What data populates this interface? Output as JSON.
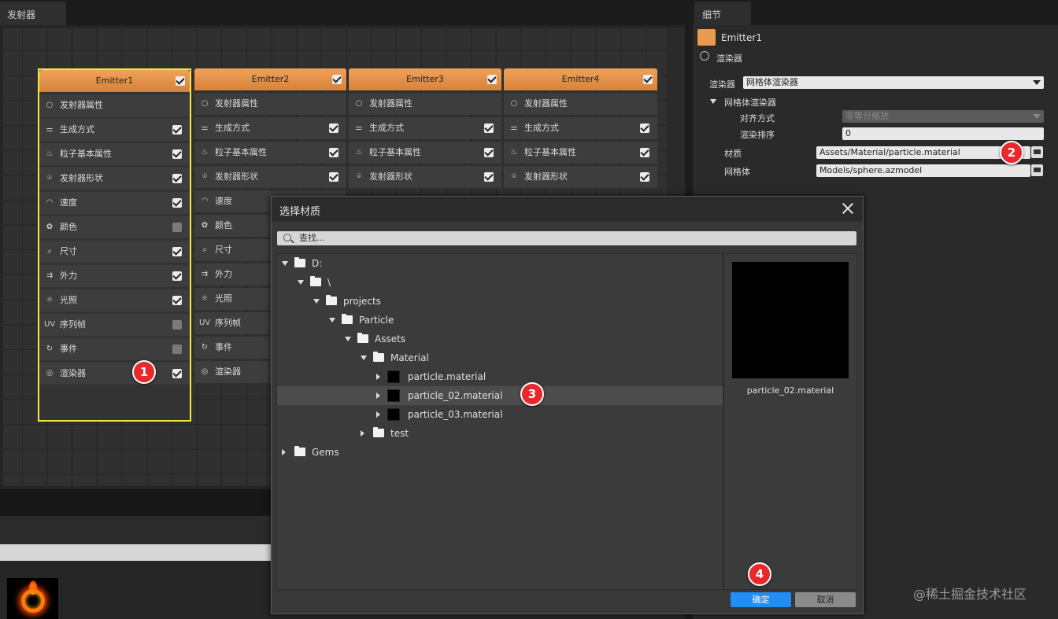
{
  "emitter_panel": {
    "tab_title": "发射器",
    "emitters": [
      {
        "name": "Emitter1",
        "enabled": true,
        "selected": true,
        "rows": [
          {
            "icon": "circle-icon",
            "label": "发射器属性",
            "checkbox": null
          },
          {
            "icon": "sliders-icon",
            "label": "生成方式",
            "checkbox": true
          },
          {
            "icon": "flame-icon",
            "label": "粒子基本属性",
            "checkbox": true
          },
          {
            "icon": "location-icon",
            "label": "发射器形状",
            "checkbox": true
          },
          {
            "icon": "gauge-icon",
            "label": "速度",
            "checkbox": true
          },
          {
            "icon": "palette-icon",
            "label": "颜色",
            "checkbox": false
          },
          {
            "icon": "ruler-icon",
            "label": "尺寸",
            "checkbox": true
          },
          {
            "icon": "arrows-icon",
            "label": "外力",
            "checkbox": true
          },
          {
            "icon": "sun-icon",
            "label": "光照",
            "checkbox": true
          },
          {
            "icon": "uv-icon",
            "label": "序列帧",
            "checkbox": false
          },
          {
            "icon": "refresh-icon",
            "label": "事件",
            "checkbox": false
          },
          {
            "icon": "renderer-icon",
            "label": "渲染器",
            "checkbox": true
          }
        ]
      },
      {
        "name": "Emitter2",
        "enabled": true,
        "selected": false,
        "rows": [
          {
            "icon": "circle-icon",
            "label": "发射器属性",
            "checkbox": null
          },
          {
            "icon": "sliders-icon",
            "label": "生成方式",
            "checkbox": true
          },
          {
            "icon": "flame-icon",
            "label": "粒子基本属性",
            "checkbox": true
          },
          {
            "icon": "location-icon",
            "label": "发射器形状",
            "checkbox": true
          },
          {
            "icon": "gauge-icon",
            "label": "速度",
            "checkbox": null
          },
          {
            "icon": "palette-icon",
            "label": "颜色",
            "checkbox": null
          },
          {
            "icon": "ruler-icon",
            "label": "尺寸",
            "checkbox": null
          },
          {
            "icon": "arrows-icon",
            "label": "外力",
            "checkbox": null
          },
          {
            "icon": "sun-icon",
            "label": "光照",
            "checkbox": null
          },
          {
            "icon": "uv-icon",
            "label": "序列帧",
            "checkbox": null
          },
          {
            "icon": "refresh-icon",
            "label": "事件",
            "checkbox": null
          },
          {
            "icon": "renderer-icon",
            "label": "渲染器",
            "checkbox": null
          }
        ]
      },
      {
        "name": "Emitter3",
        "enabled": true,
        "selected": false,
        "rows": [
          {
            "icon": "circle-icon",
            "label": "发射器属性",
            "checkbox": null
          },
          {
            "icon": "sliders-icon",
            "label": "生成方式",
            "checkbox": true
          },
          {
            "icon": "flame-icon",
            "label": "粒子基本属性",
            "checkbox": true
          },
          {
            "icon": "location-icon",
            "label": "发射器形状",
            "checkbox": true
          }
        ]
      },
      {
        "name": "Emitter4",
        "enabled": true,
        "selected": false,
        "rows": [
          {
            "icon": "circle-icon",
            "label": "发射器属性",
            "checkbox": null
          },
          {
            "icon": "sliders-icon",
            "label": "生成方式",
            "checkbox": true
          },
          {
            "icon": "flame-icon",
            "label": "粒子基本属性",
            "checkbox": true
          },
          {
            "icon": "location-icon",
            "label": "发射器形状",
            "checkbox": true
          }
        ]
      }
    ]
  },
  "details_panel": {
    "tab_title": "细节",
    "emitter_name": "Emitter1",
    "section_title": "渲染器",
    "renderer_label": "渲染器",
    "renderer_value": "网格体渲染器",
    "mesh_renderer_group": "网格体渲染器",
    "alignment_label": "对齐方式",
    "alignment_value": "非等分缩放",
    "sort_label": "渲染排序",
    "sort_value": "0",
    "material_label": "材质",
    "material_value": "Assets/Material/particle.material",
    "mesh_label": "网格体",
    "mesh_value": "Models/sphere.azmodel"
  },
  "dialog": {
    "title": "选择材质",
    "search_placeholder": "查找...",
    "tree": [
      {
        "label": "D:",
        "type": "folder",
        "expanded": true
      },
      {
        "label": "\\",
        "type": "folder",
        "expanded": true
      },
      {
        "label": "projects",
        "type": "folder",
        "expanded": true
      },
      {
        "label": "Particle",
        "type": "folder",
        "expanded": true
      },
      {
        "label": "Assets",
        "type": "folder",
        "expanded": true
      },
      {
        "label": "Material",
        "type": "folder",
        "expanded": true
      },
      {
        "label": "particle.material",
        "type": "file",
        "expanded": false
      },
      {
        "label": "particle_02.material",
        "type": "file",
        "expanded": false,
        "selected": true
      },
      {
        "label": "particle_03.material",
        "type": "file",
        "expanded": false
      },
      {
        "label": "test",
        "type": "folder",
        "expanded": false
      },
      {
        "label": "Gems",
        "type": "folder",
        "expanded": false
      }
    ],
    "preview_name": "particle_02.material",
    "ok_label": "确定",
    "cancel_label": "取消"
  },
  "badges": [
    "1",
    "2",
    "3",
    "4"
  ],
  "watermark": "@稀土掘金技术社区",
  "colors": {
    "emitter_header": "#e89a4e",
    "selection_outline": "#f3ea3a",
    "ok_button": "#1f8ef5",
    "badge": "#e8282b"
  }
}
